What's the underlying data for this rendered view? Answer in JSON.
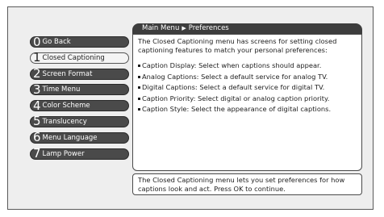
{
  "breadcrumb": {
    "parent": "Main Menu",
    "separator": "▶",
    "current": "Preferences"
  },
  "menu": [
    {
      "num": "0",
      "label": "Go Back",
      "selected": false
    },
    {
      "num": "1",
      "label": "Closed Captioning",
      "selected": true
    },
    {
      "num": "2",
      "label": "Screen Format",
      "selected": false
    },
    {
      "num": "3",
      "label": "Time Menu",
      "selected": false
    },
    {
      "num": "4",
      "label": "Color Scheme",
      "selected": false
    },
    {
      "num": "5",
      "label": "Translucency",
      "selected": false
    },
    {
      "num": "6",
      "label": "Menu Language",
      "selected": false
    },
    {
      "num": "7",
      "label": "Lamp Power",
      "selected": false
    }
  ],
  "content": {
    "intro": "The Closed Captioning menu has screens for setting closed captioning features to match your personal preferences:",
    "bullets": [
      "Caption Display: Select when captions should appear.",
      "Analog Captions: Select a default service for analog TV.",
      "Digital Captions: Select a default service for digital TV.",
      "Caption Priority: Select digital or analog caption priority.",
      "Caption Style: Select the appearance of digital captions."
    ]
  },
  "footer": "The Closed Captioning menu lets you set preferences for how captions look and act. Press OK to continue."
}
